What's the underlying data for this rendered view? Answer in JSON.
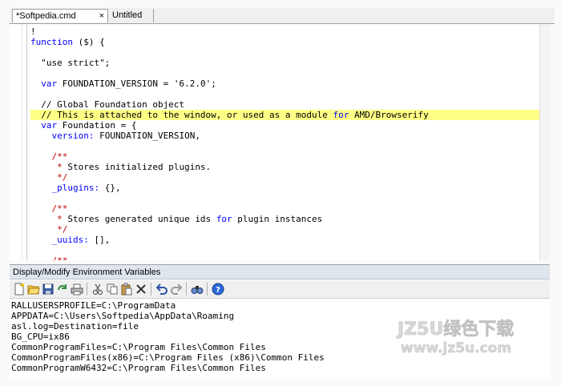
{
  "tabs": [
    {
      "label": "*Softpedia.cmd",
      "close": "×"
    },
    {
      "label": "Untitled"
    }
  ],
  "code_lines": [
    [
      {
        "t": "!",
        "c": ""
      }
    ],
    [
      {
        "t": "function",
        "c": "kw"
      },
      {
        "t": " ($) {",
        "c": ""
      }
    ],
    [],
    [
      {
        "t": "  \"use strict\";",
        "c": ""
      }
    ],
    [],
    [
      {
        "t": "  ",
        "c": ""
      },
      {
        "t": "var",
        "c": "kw"
      },
      {
        "t": " FOUNDATION_VERSION = ",
        "c": ""
      },
      {
        "t": "'6.2.0'",
        "c": ""
      },
      {
        "t": ";",
        "c": ""
      }
    ],
    [],
    [
      {
        "t": "  // Global Foundation object",
        "c": ""
      }
    ],
    [
      {
        "t": "  // This is attached to the window, or used as a module ",
        "c": ""
      },
      {
        "t": "for",
        "c": "kw"
      },
      {
        "t": " AMD/Browserify",
        "c": ""
      }
    ],
    [
      {
        "t": "  ",
        "c": ""
      },
      {
        "t": "var",
        "c": "kw"
      },
      {
        "t": " Foundation = {",
        "c": ""
      }
    ],
    [
      {
        "t": "    ",
        "c": ""
      },
      {
        "t": "version:",
        "c": "kw"
      },
      {
        "t": " FOUNDATION_VERSION,",
        "c": ""
      }
    ],
    [],
    [
      {
        "t": "    ",
        "c": ""
      },
      {
        "t": "/**",
        "c": "cm-red"
      }
    ],
    [
      {
        "t": "     ",
        "c": ""
      },
      {
        "t": "*",
        "c": "cm-red"
      },
      {
        "t": " Stores initialized plugins.",
        "c": ""
      }
    ],
    [
      {
        "t": "     ",
        "c": ""
      },
      {
        "t": "*/",
        "c": "cm-red"
      }
    ],
    [
      {
        "t": "    ",
        "c": ""
      },
      {
        "t": "_plugins:",
        "c": "kw"
      },
      {
        "t": " {},",
        "c": ""
      }
    ],
    [],
    [
      {
        "t": "    ",
        "c": ""
      },
      {
        "t": "/**",
        "c": "cm-red"
      }
    ],
    [
      {
        "t": "     ",
        "c": ""
      },
      {
        "t": "*",
        "c": "cm-red"
      },
      {
        "t": " Stores generated unique ids ",
        "c": ""
      },
      {
        "t": "for",
        "c": "kw"
      },
      {
        "t": " plugin instances",
        "c": ""
      }
    ],
    [
      {
        "t": "     ",
        "c": ""
      },
      {
        "t": "*/",
        "c": "cm-red"
      }
    ],
    [
      {
        "t": "    ",
        "c": ""
      },
      {
        "t": "_uuids:",
        "c": "kw"
      },
      {
        "t": " [],",
        "c": ""
      }
    ],
    [],
    [
      {
        "t": "    ",
        "c": ""
      },
      {
        "t": "/**",
        "c": "cm-red"
      }
    ]
  ],
  "highlighted_line_index": 8,
  "panel": {
    "title": "Display/Modify Environment Variables",
    "toolbar": [
      "new-icon",
      "open-icon",
      "save-icon",
      "revert-icon",
      "print-icon",
      "cut-icon",
      "copy-icon",
      "paste-icon",
      "delete-icon",
      "undo-icon",
      "redo-icon",
      "find-icon",
      "help-icon"
    ],
    "env_vars": [
      "RALLUSERSPROFILE=C:\\ProgramData",
      "APPDATA=C:\\Users\\Softpedia\\AppData\\Roaming",
      "asl.log=Destination=file",
      "BG_CPU=ix86",
      "CommonProgramFiles=C:\\Program Files\\Common Files",
      "CommonProgramFiles(x86)=C:\\Program Files (x86)\\Common Files",
      "CommonProgramW6432=C:\\Program Files\\Common Files"
    ]
  },
  "watermark": {
    "line1": "JZ5U绿色下载",
    "line2": "www.jz5u.com"
  },
  "colors": {
    "keyword": "#0000ff",
    "highlight": "#ffff88",
    "comment_marker": "#c00000"
  }
}
